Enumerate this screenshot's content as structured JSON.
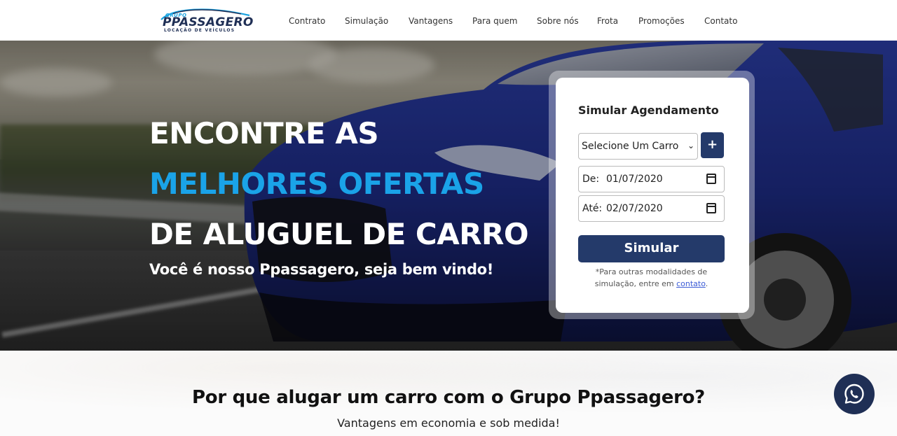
{
  "brand": {
    "small": "GRUPO",
    "name": "PPASSAGERO",
    "tagline": "LOCAÇÃO DE VEÍCULOS"
  },
  "nav": {
    "items": [
      "Contrato",
      "Simulação",
      "Vantagens",
      "Para quem",
      "Sobre nós",
      "Frota",
      "Promoções",
      "Contato"
    ]
  },
  "hero": {
    "line1": "ENCONTRE AS",
    "line2": "MELHORES OFERTAS",
    "line3": "DE ALUGUEL DE CARRO",
    "subtitle": "Você é nosso Ppassagero, seja bem vindo!"
  },
  "form": {
    "title": "Simular Agendamento",
    "car_select": "Selecione Um Carro",
    "plus_label": "+",
    "from_label": "De:",
    "from_value": "01/07/2020",
    "to_label": "Até:",
    "to_value": "02/07/2020",
    "submit_label": "Simular",
    "note_prefix": "*Para outras modalidades de simulação, entre em",
    "note_link": "contato",
    "note_suffix": "."
  },
  "section": {
    "title": "Por que alugar um carro com o Grupo Ppassagero?",
    "subtitle": "Vantagens em economia e sob medida!"
  },
  "colors": {
    "accent": "#1aa3e8",
    "navy": "#243a6a",
    "whatsapp_bg": "#1f2f55"
  },
  "icons": {
    "whatsapp": "whatsapp-icon",
    "calendar": "calendar-icon",
    "chevron": "chevron-down-icon"
  }
}
